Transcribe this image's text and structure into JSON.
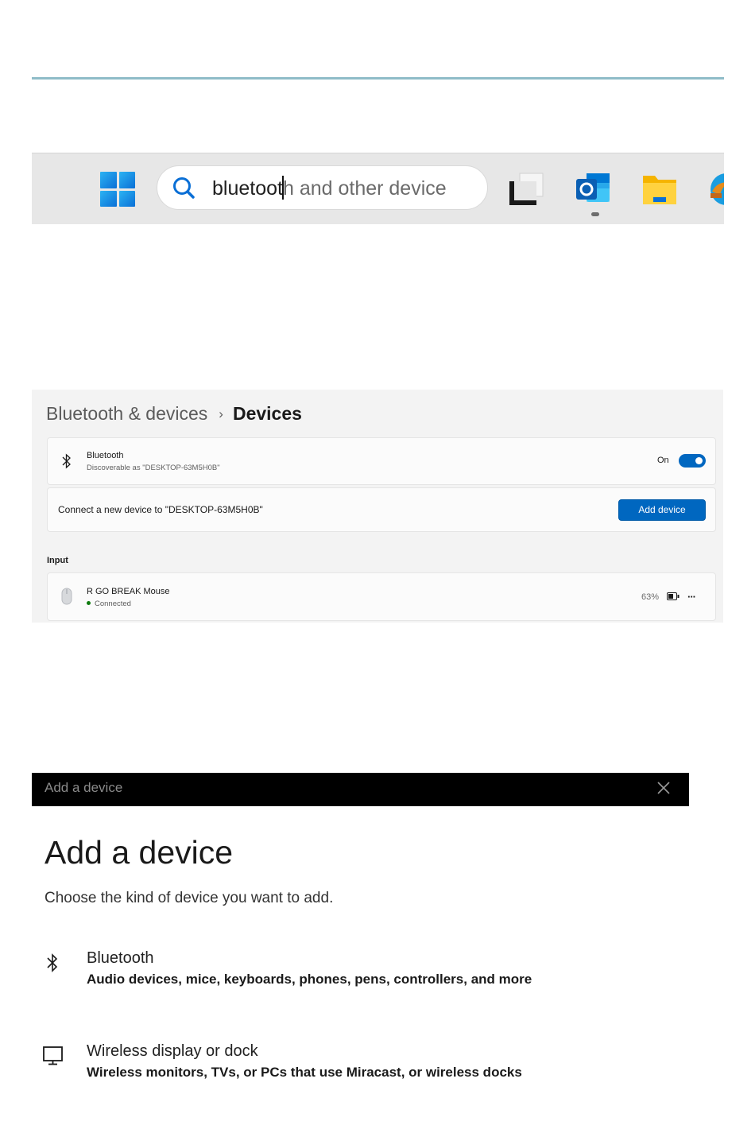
{
  "taskbar": {
    "search": {
      "typed": "bluetooth",
      "remaining": "h and other device",
      "typed_prefix": "bluetoot"
    },
    "icons": [
      "windows-start-icon",
      "task-view-icon",
      "outlook-icon",
      "file-explorer-icon",
      "edge-icon"
    ]
  },
  "settings": {
    "breadcrumb": {
      "parent": "Bluetooth & devices",
      "separator": "›",
      "current": "Devices"
    },
    "bluetooth_card": {
      "title": "Bluetooth",
      "subtitle": "Discoverable as \"DESKTOP-63M5H0B\"",
      "state_label": "On",
      "enabled": true
    },
    "connect_card": {
      "text": "Connect a new device to \"DESKTOP-63M5H0B\"",
      "button_label": "Add device"
    },
    "section_input": "Input",
    "devices": [
      {
        "name": "R GO BREAK Mouse",
        "status": "Connected",
        "battery": "63%"
      }
    ],
    "more_label": "···"
  },
  "dialog": {
    "window_title": "Add a device",
    "heading": "Add a device",
    "subtitle": "Choose the kind of device you want to add.",
    "options": [
      {
        "title": "Bluetooth",
        "description": "Audio devices, mice, keyboards, phones, pens, controllers, and more",
        "icon": "bluetooth-icon"
      },
      {
        "title": "Wireless display or dock",
        "description": "Wireless monitors, TVs, or PCs that use Miracast, or wireless docks",
        "icon": "monitor-icon"
      }
    ]
  },
  "colors": {
    "accent": "#0067c0",
    "divider": "#8fbcc8",
    "taskbar_bg": "#e7e7e7",
    "settings_bg": "#f3f3f3",
    "titlebar_bg": "#000000"
  }
}
